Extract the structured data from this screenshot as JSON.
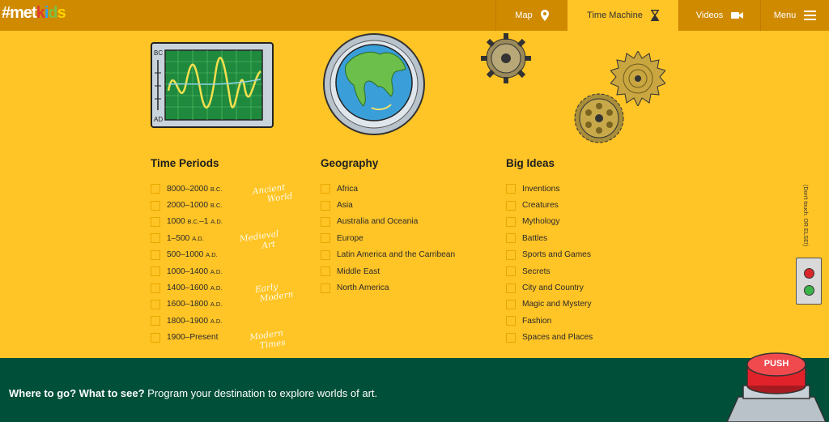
{
  "header": {
    "logo": {
      "hash": "#",
      "parts": [
        {
          "text": "m",
          "color": "#ffffff"
        },
        {
          "text": "e",
          "color": "#ffffff"
        },
        {
          "text": "t",
          "color": "#ffffff"
        },
        {
          "text": "k",
          "color": "#e03c31"
        },
        {
          "text": "i",
          "color": "#2ea3f2"
        },
        {
          "text": "d",
          "color": "#7ac143"
        },
        {
          "text": "s",
          "color": "#ffd200"
        }
      ]
    },
    "nav": {
      "map": "Map",
      "time_machine": "Time Machine",
      "videos": "Videos",
      "menu": "Menu"
    }
  },
  "illustrations": {
    "monitor_top": "BC",
    "monitor_bottom": "AD"
  },
  "time_periods": {
    "title": "Time Periods",
    "items": [
      {
        "num": "8000–2000",
        "era": "B.C."
      },
      {
        "num": "2000–1000",
        "era": "B.C."
      },
      {
        "num": "1000 ",
        "era": "B.C.",
        "num2": "–1 ",
        "era2": "A.D."
      },
      {
        "num": "1–500",
        "era": "A.D."
      },
      {
        "num": "500–1000",
        "era": "A.D."
      },
      {
        "num": "1000–1400",
        "era": "A.D."
      },
      {
        "num": "1400–1600",
        "era": "A.D."
      },
      {
        "num": "1600–1800",
        "era": "A.D."
      },
      {
        "num": "1800–1900",
        "era": "A.D."
      },
      {
        "num": "1900–Present",
        "era": ""
      }
    ],
    "annotations": {
      "ancient": [
        "Ancient",
        "World"
      ],
      "medieval": [
        "Medieval",
        "Art"
      ],
      "early_modern": [
        "Early",
        "Modern"
      ],
      "modern_times": [
        "Modern",
        "Times"
      ]
    }
  },
  "geography": {
    "title": "Geography",
    "items": [
      "Africa",
      "Asia",
      "Australia and Oceania",
      "Europe",
      "Latin America and the Carribean",
      "Middle East",
      "North America"
    ]
  },
  "big_ideas": {
    "title": "Big Ideas",
    "items": [
      "Inventions",
      "Creatures",
      "Mythology",
      "Battles",
      "Sports and Games",
      "Secrets",
      "City and Country",
      "Magic and Mystery",
      "Fashion",
      "Spaces and Places"
    ]
  },
  "side": {
    "note": "(Don't touch. OR ELSE!)"
  },
  "footer": {
    "bold": "Where to go? What to see?",
    "text": " Program your destination to explore worlds of art.",
    "push_label": "PUSH"
  },
  "colors": {
    "background": "#ffc425",
    "header": "#d08a00",
    "footer": "#004f38",
    "push": "#e2222a"
  }
}
